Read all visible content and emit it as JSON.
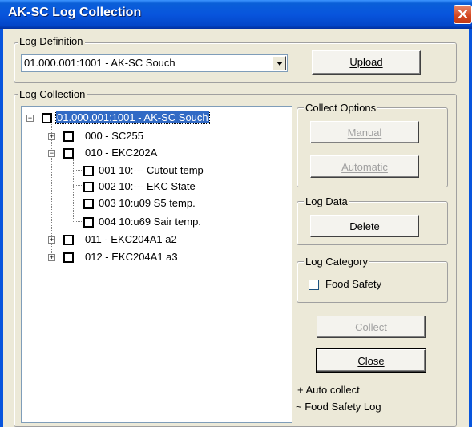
{
  "window": {
    "title": "AK-SC Log Collection"
  },
  "log_definition": {
    "group_label": "Log Definition",
    "selected_value": "01.000.001:1001 - AK-SC Souch",
    "upload_label": "Upload"
  },
  "log_collection": {
    "group_label": "Log Collection",
    "tree": [
      {
        "label": "01.000.001:1001 - AK-SC Souch",
        "expander": "−",
        "selected": true
      },
      {
        "label": "000 - SC255",
        "expander": "+"
      },
      {
        "label": "010 - EKC202A",
        "expander": "−"
      },
      {
        "label": "001  10:--- Cutout temp"
      },
      {
        "label": "002  10:--- EKC State"
      },
      {
        "label": "003  10:u09 S5 temp."
      },
      {
        "label": "004  10:u69 Sair temp."
      },
      {
        "label": "011 - EKC204A1 a2",
        "expander": "+"
      },
      {
        "label": "012 - EKC204A1 a3",
        "expander": "+"
      }
    ]
  },
  "collect_options": {
    "group_label": "Collect Options",
    "manual_label": "Manual",
    "automatic_label": "Automatic"
  },
  "log_data": {
    "group_label": "Log Data",
    "delete_label": "Delete"
  },
  "log_category": {
    "group_label": "Log Category",
    "food_safety_label": "Food Safety",
    "food_safety_checked": false
  },
  "actions": {
    "collect_label": "Collect",
    "close_label": "Close"
  },
  "legend": {
    "auto_collect": "+  Auto collect",
    "food_safety_log": "~  Food Safety Log"
  }
}
